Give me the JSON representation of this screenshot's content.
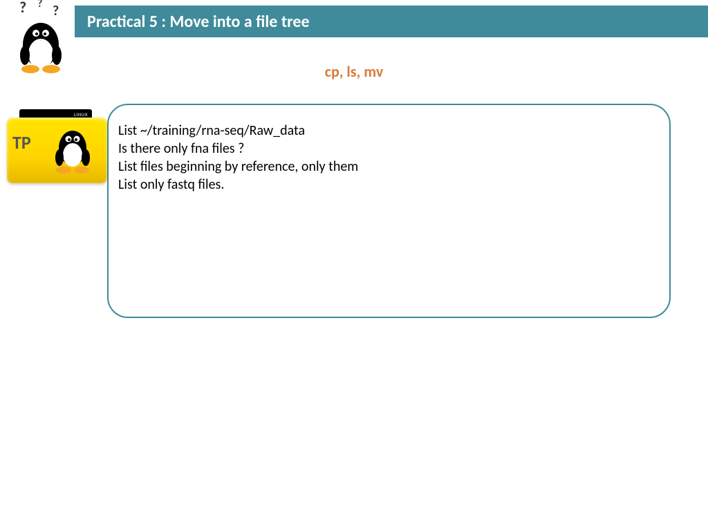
{
  "header": {
    "title": "Practical 5 : Move into a file tree"
  },
  "subtitle": "cp, ls, mv",
  "tp": {
    "label": "TP",
    "tab": "LINUX"
  },
  "instructions": [
    "List ~/training/rna-seq/Raw_data",
    "Is there only fna files ?",
    "List files beginning by reference, only them",
    "List only fastq files."
  ]
}
